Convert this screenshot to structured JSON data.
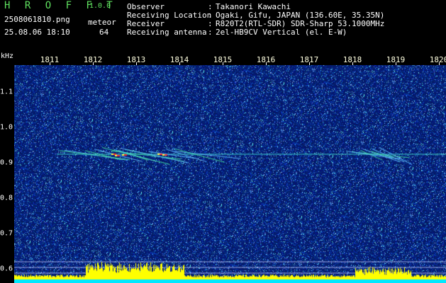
{
  "header": {
    "app_title": "H R O F F T",
    "version": "1.0.0",
    "filename": "2508061810.png",
    "datetime": "25.08.06 18:10",
    "mode_label": "meteor",
    "count": "64",
    "info": [
      {
        "label": "Observer",
        "value": "Takanori Kawachi"
      },
      {
        "label": "Receiving Location",
        "value": "Ogaki, Gifu, JAPAN (136.60E, 35.35N)"
      },
      {
        "label": "Receiver",
        "value": "R820T2(RTL-SDR) SDR-Sharp 53.1000MHz"
      },
      {
        "label": "Receiving antenna",
        "value": "2el-HB9CV Vertical (el. E-W)"
      }
    ]
  },
  "axis": {
    "freq_unit": "kHz",
    "minute_labels": [
      "1811",
      "1812",
      "1813",
      "1814",
      "1815",
      "1816",
      "1817",
      "1818",
      "1819",
      "1820"
    ],
    "freq_labels": [
      "1.1",
      "1.0",
      "0.9",
      "0.8",
      "0.7",
      "0.6"
    ]
  },
  "colors": {
    "background_noise": "#0a1a6a",
    "signal_line": "#40e0d0",
    "echo_hot": "#ff3030",
    "histogram": "#ffff00",
    "baseline": "#00ffff"
  },
  "spectrogram": {
    "carrier_freq_khz": 0.92,
    "freq_range_khz": [
      0.58,
      1.2
    ],
    "time_range": [
      "1810.5",
      "1820.1"
    ],
    "meteor_echoes": [
      {
        "start_min": 1811.8,
        "end_min": 1814.3,
        "intensity": 0.9
      },
      {
        "start_min": 1818.0,
        "end_min": 1819.3,
        "intensity": 0.7
      }
    ]
  }
}
